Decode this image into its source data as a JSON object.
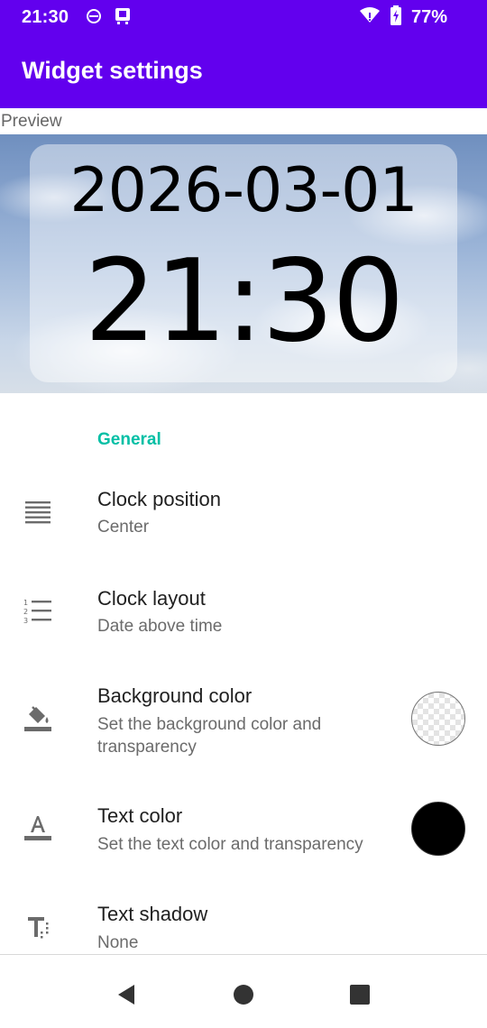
{
  "status_bar": {
    "time": "21:30",
    "battery_percent": "77%",
    "icons": [
      "notification-a-icon",
      "notification-b-icon",
      "wifi-icon",
      "battery-charging-icon"
    ]
  },
  "app_bar": {
    "title": "Widget settings",
    "color": "#6200ee"
  },
  "preview": {
    "label": "Preview",
    "date": "2026-03-01",
    "time": "21:30"
  },
  "general": {
    "header": "General",
    "accent_color": "#00bfa5",
    "items": [
      {
        "icon": "align-lines-icon",
        "title": "Clock position",
        "summary": "Center"
      },
      {
        "icon": "numbered-list-icon",
        "title": "Clock layout",
        "summary": "Date above time"
      },
      {
        "icon": "paint-bucket-icon",
        "title": "Background color",
        "summary": "Set the background color and transparency",
        "swatch": "transparent"
      },
      {
        "icon": "text-color-icon",
        "title": "Text color",
        "summary": "Set the text color and transparency",
        "swatch": "#000000"
      },
      {
        "icon": "text-shadow-icon",
        "title": "Text shadow",
        "summary": "None"
      }
    ]
  },
  "nav_bar": {
    "buttons": [
      "back-icon",
      "home-icon",
      "recents-icon"
    ]
  }
}
